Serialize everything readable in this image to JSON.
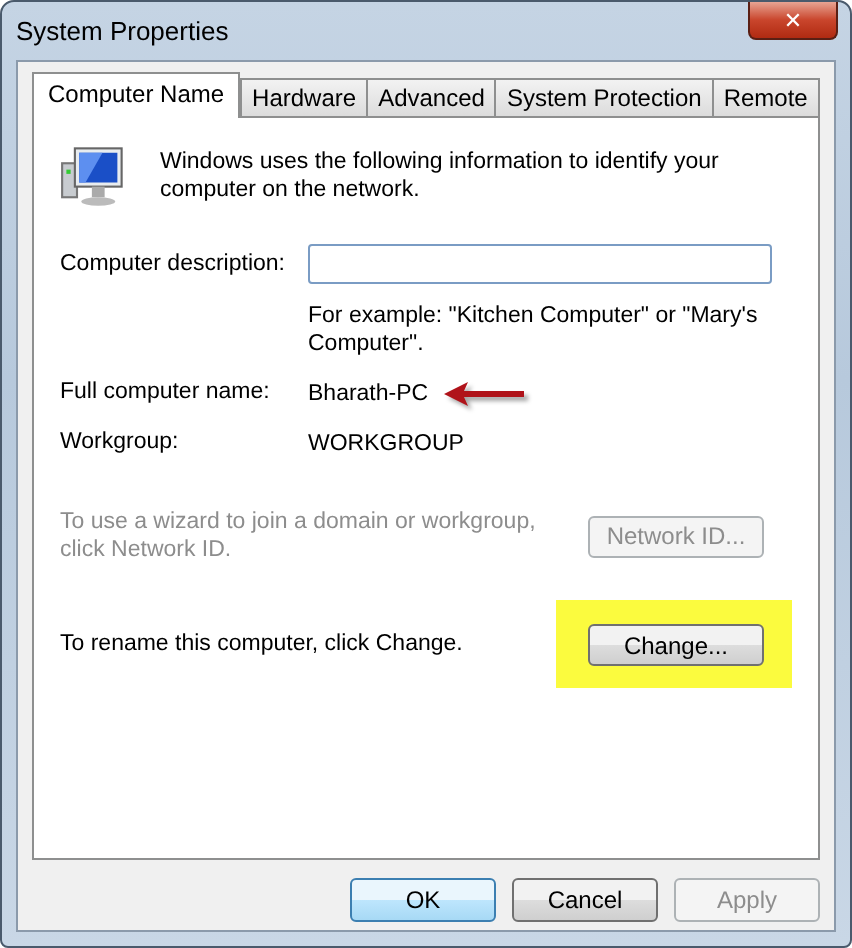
{
  "window": {
    "title": "System Properties",
    "close": "✕"
  },
  "tabs": [
    {
      "label": "Computer Name",
      "selected": true
    },
    {
      "label": "Hardware",
      "selected": false
    },
    {
      "label": "Advanced",
      "selected": false
    },
    {
      "label": "System Protection",
      "selected": false
    },
    {
      "label": "Remote",
      "selected": false
    }
  ],
  "intro": "Windows uses the following information to identify your computer on the network.",
  "description": {
    "label": "Computer description:",
    "hint": "For example: \"Kitchen Computer\" or \"Mary's Computer\"."
  },
  "info_rows": [
    {
      "label": "Full computer name:",
      "value": "Bharath-PC",
      "arrow_marked": true
    },
    {
      "label": "Workgroup:",
      "value": "WORKGROUP",
      "arrow_marked": false
    }
  ],
  "actions": [
    {
      "text": "To use a wizard to join a domain or workgroup, click Network ID.",
      "button": "Network ID...",
      "disabled": true,
      "highlighted": false
    },
    {
      "text": "To rename this computer, click Change.",
      "button": "Change...",
      "disabled": false,
      "highlighted": true
    }
  ],
  "buttons": [
    {
      "label": "OK",
      "default": true,
      "disabled": false
    },
    {
      "label": "Cancel",
      "default": false,
      "disabled": false
    },
    {
      "label": "Apply",
      "default": false,
      "disabled": true
    }
  ]
}
